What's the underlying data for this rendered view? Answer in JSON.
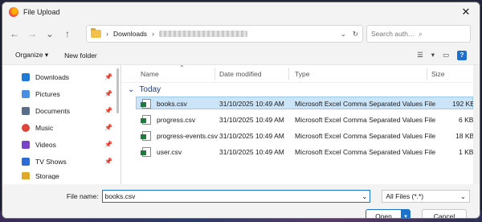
{
  "window": {
    "title": "File Upload",
    "close_glyph": "✕"
  },
  "address": {
    "path_root": "Downloads",
    "search_placeholder": "Search auth0_6790512b4fc5..."
  },
  "toolbar": {
    "organize": "Organize ▾",
    "new_folder": "New folder"
  },
  "sidebar": {
    "items": [
      {
        "label": "Downloads",
        "icon": "download-icon",
        "color": "#1e7ad6"
      },
      {
        "label": "Pictures",
        "icon": "pictures-icon",
        "color": "#4a90e2"
      },
      {
        "label": "Documents",
        "icon": "documents-icon",
        "color": "#5a6d8a"
      },
      {
        "label": "Music",
        "icon": "music-icon",
        "color": "#e0453a"
      },
      {
        "label": "Videos",
        "icon": "videos-icon",
        "color": "#7a44c9"
      },
      {
        "label": "TV Shows",
        "icon": "tv-shows-icon",
        "color": "#2e6bd6"
      },
      {
        "label": "Storage",
        "icon": "storage-icon",
        "color": "#e0a92a"
      }
    ]
  },
  "columns": {
    "name": "Name",
    "date": "Date modified",
    "type": "Type",
    "size": "Size"
  },
  "group": {
    "label": "Today",
    "chevron": "⌄"
  },
  "files": [
    {
      "name": "books.csv",
      "date": "31/10/2025 10:49 AM",
      "type": "Microsoft Excel Comma Separated Values File",
      "size": "192 KB"
    },
    {
      "name": "progress.csv",
      "date": "31/10/2025 10:49 AM",
      "type": "Microsoft Excel Comma Separated Values File",
      "size": "6 KB"
    },
    {
      "name": "progress-events.csv",
      "date": "31/10/2025 10:49 AM",
      "type": "Microsoft Excel Comma Separated Values File",
      "size": "18 KB"
    },
    {
      "name": "user.csv",
      "date": "31/10/2025 10:49 AM",
      "type": "Microsoft Excel Comma Separated Values File",
      "size": "1 KB"
    }
  ],
  "footer": {
    "file_name_label": "File name:",
    "file_name_value": "books.csv",
    "filter_value": "All Files (*.*)",
    "open_label": "Open",
    "cancel_label": "Cancel"
  }
}
